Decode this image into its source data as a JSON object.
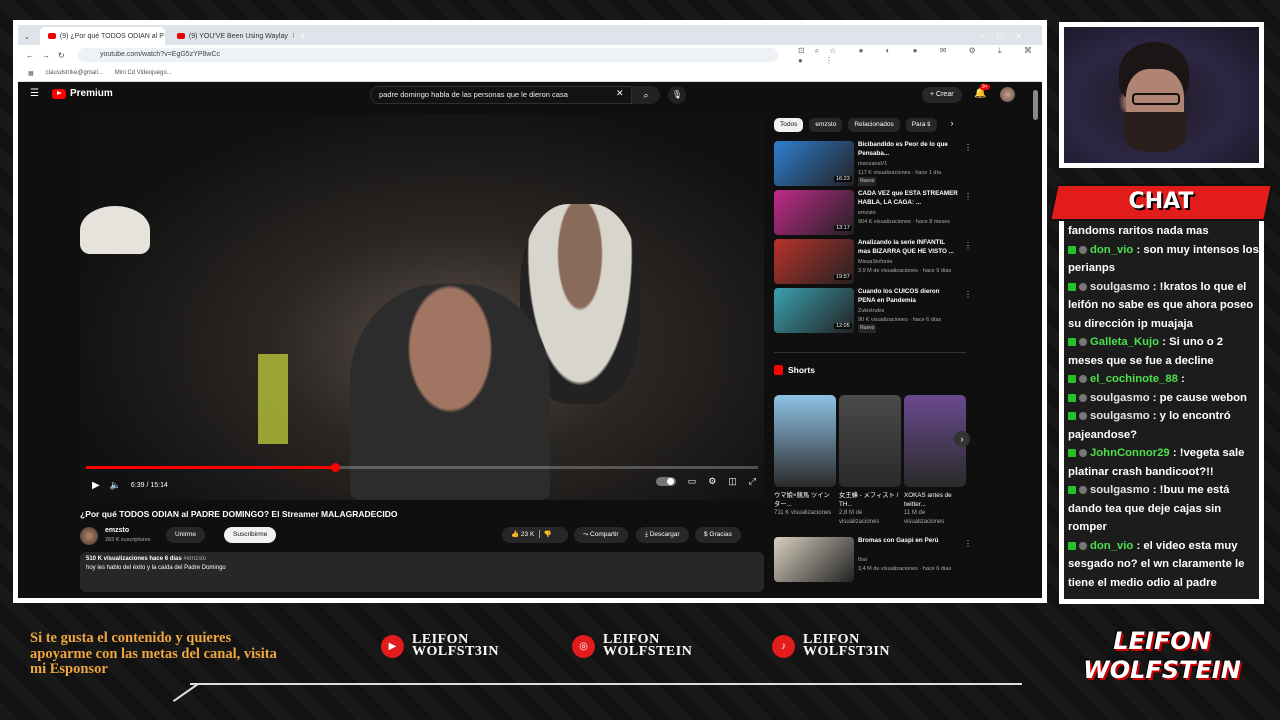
{
  "browser": {
    "tabs": [
      {
        "label": "(9) ¿Por qué TODOS ODIAN al P",
        "active": true
      },
      {
        "label": "(9) YOU'VE Been Using Waylay",
        "active": false
      }
    ],
    "url": "youtube.com/watch?v=EgG5zYP8wCc",
    "bookmarks": [
      "clausdstrike@gmail...",
      "Mini Cd Videojuego..."
    ]
  },
  "youtube": {
    "logo": "Premium",
    "search_query": "padre domingo habla de las personas que le dieron casa",
    "create_label": "Crear",
    "notif_badge": "9+",
    "player": {
      "time": "6:39 / 15:14",
      "progress": 0.37
    },
    "video_title": "¿Por qué TODOS ODIAN al PADRE DOMINGO? El Streamer MALAGRADECIDO",
    "channel": {
      "name": "emzsto",
      "subs": "283 K suscriptores",
      "join": "Unirme",
      "subscribe": "Suscribirme"
    },
    "actions": {
      "likes": "23 K",
      "share": "Compartir",
      "download": "Descargar",
      "thanks": "Gracias"
    },
    "description": {
      "meta": "510 K visualizaciones  hace 6 días",
      "tag": "#emzsto",
      "text": "hoy les hablo del éxito y la caída del Padre Domingo"
    },
    "chips": [
      "Todos",
      "emzsto",
      "Relacionados",
      "Para ti"
    ],
    "recommendations": [
      {
        "title": "Bicibandido es Peor de lo que Pensaba...",
        "channel": "manzanaV1",
        "meta": "117 K visualizaciones · hace 1 día",
        "badge": "Nuevo",
        "duration": "16:23",
        "color": "#2f7fd0"
      },
      {
        "title": "CADA VEZ que ESTA STREAMER HABLA, LA CAGA: ...",
        "channel": "emzsto",
        "meta": "904 K visualizaciones · hace 8 meses",
        "badge": "",
        "duration": "13:17",
        "color": "#c02a8a"
      },
      {
        "title": "Analizando la serie INFANTIL mas BIZARRA QUE HE VISTO ...",
        "channel": "MissaSinfonia",
        "meta": "3,9 M de visualizaciones · hace 9 días",
        "badge": "",
        "duration": "19:57",
        "color": "#b8322a"
      },
      {
        "title": "Cuando los CUICOS dieron PENA en Pandemia",
        "channel": "Zukistrukis",
        "meta": "90 K visualizaciones · hace 6 días",
        "badge": "Nuevo",
        "duration": "12:05",
        "color": "#3aa0b0"
      },
      {
        "title": "Bromas con Gaspi en Perú",
        "channel": "Ibai",
        "meta": "3,4 M de visualizaciones · hace 6 días",
        "badge": "",
        "duration": "",
        "color": "#d8d0c0"
      }
    ],
    "shorts_label": "Shorts",
    "shorts": [
      {
        "title": "ウマ娘×競馬 ツインター...",
        "meta": "711 K visualizaciones",
        "color": "#8ec3e6"
      },
      {
        "title": "女王蜂 - メフィスト / TH...",
        "meta": "2,8 M de visualizaciones",
        "color": "#4a4a4a"
      },
      {
        "title": "XOKAS antes de twitter...",
        "meta": "11 M de visualizaciones",
        "color": "#6a4a90"
      }
    ]
  },
  "chat": {
    "title": "CHAT",
    "messages": [
      {
        "user": "",
        "text": "fandoms raritos nada mas"
      },
      {
        "user": "don_vio",
        "text": ": son muy intensos los perianps",
        "color": "#4ce04c"
      },
      {
        "user": "soulgasmo",
        "text": ": !kratos lo que el leifón no sabe es que ahora poseo su dirección ip muajaja",
        "color": "#e3e3e3"
      },
      {
        "user": "Galleta_Kujo",
        "text": ": Si uno o 2 meses que se fue a decline",
        "color": "#4ce04c"
      },
      {
        "user": "el_cochinote_88",
        "text": ":",
        "color": "#4ce04c"
      },
      {
        "user": "soulgasmo",
        "text": ": pe cause webon",
        "color": "#e3e3e3"
      },
      {
        "user": "soulgasmo",
        "text": ": y lo encontró pajeandose?",
        "color": "#e3e3e3"
      },
      {
        "user": "JohnConnor29",
        "text": ": !vegeta sale platinar crash bandicoot?!!",
        "color": "#4ce04c"
      },
      {
        "user": "soulgasmo",
        "text": ": !buu me está dando tea que deje cajas sin romper",
        "color": "#e3e3e3"
      },
      {
        "user": "don_vio",
        "text": ": el video esta muy sesgado no? el wn claramente le tiene el medio odio al padre",
        "color": "#4ce04c"
      }
    ]
  },
  "footer": {
    "sponsor_text": "Si te gusta el contenido y quieres apoyarme con las metas del canal, visita mi Esponsor",
    "socials": [
      {
        "icon": "youtube-icon",
        "line1": "LEIFON",
        "line2": "WOLFST3IN"
      },
      {
        "icon": "instagram-icon",
        "line1": "LEIFON",
        "line2": "WOLFSTEIN"
      },
      {
        "icon": "tiktok-icon",
        "line1": "LEIFON",
        "line2": "WOLFST3IN"
      }
    ],
    "brand_line1": "LEIFON",
    "brand_line2": "WOLFSTEIN"
  }
}
